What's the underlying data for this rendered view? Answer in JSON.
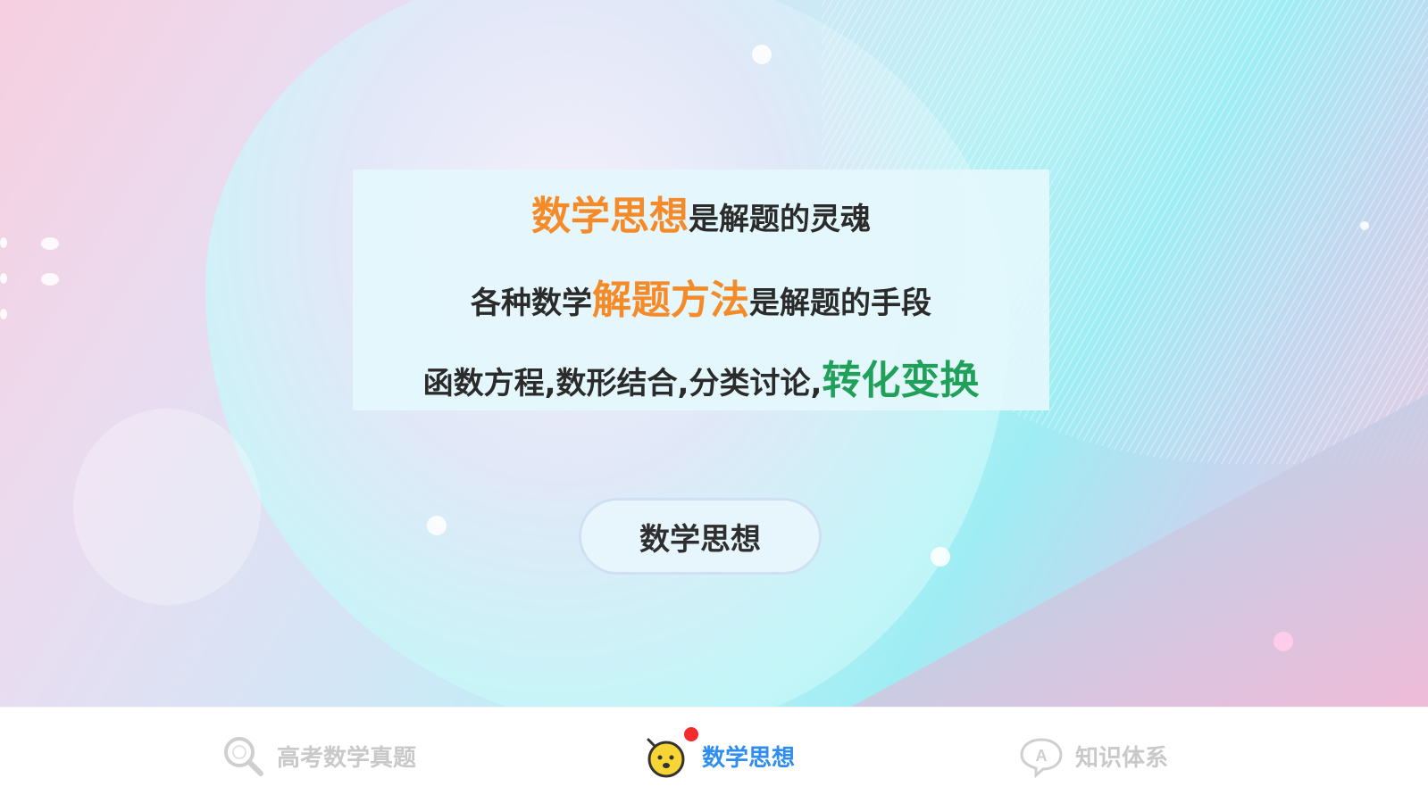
{
  "hero": {
    "line1": {
      "highlight": "数学思想",
      "rest": "是解题的灵魂"
    },
    "line2": {
      "prefix": "各种数学",
      "highlight": "解题方法",
      "suffix": "是解题的手段"
    },
    "line3": {
      "prefix": "函数方程,数形结合,分类讨论,",
      "highlight": "转化变换"
    },
    "button_label": "数学思想"
  },
  "tabbar": {
    "tabs": [
      {
        "label": "高考数学真题",
        "icon": "search-icon",
        "active": false
      },
      {
        "label": "数学思想",
        "icon": "mascot-icon",
        "active": true,
        "badge": true
      },
      {
        "label": "知识体系",
        "icon": "a-bubble-icon",
        "active": false
      }
    ]
  },
  "colors": {
    "highlight_orange": "#f58a28",
    "highlight_green": "#21a05a",
    "active_tab": "#2f8df0",
    "inactive_tab": "#c9c9c9",
    "badge": "#f22b2b"
  }
}
